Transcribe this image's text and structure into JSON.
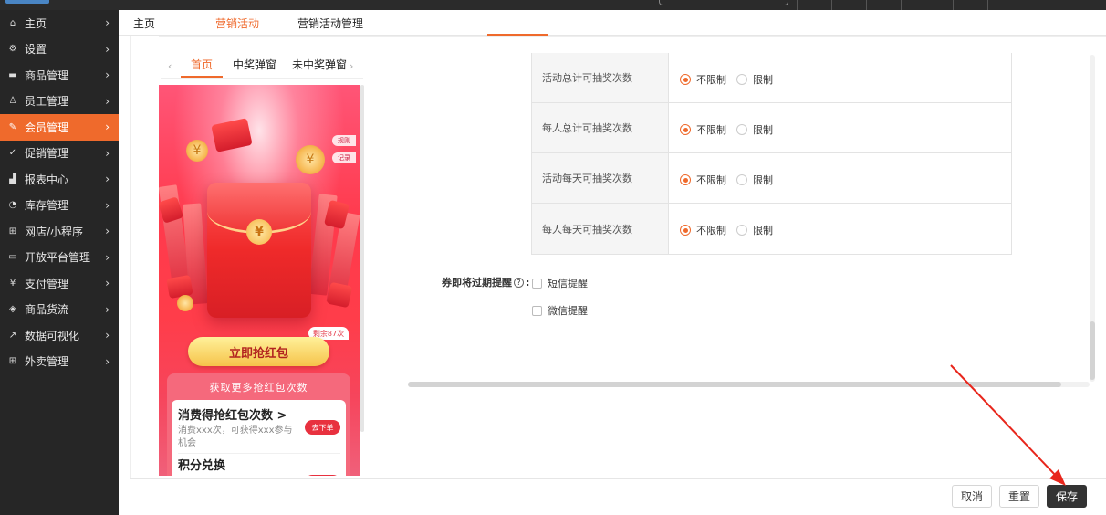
{
  "sidebar": {
    "items": [
      {
        "label": "主页",
        "icon": "home-icon",
        "glyph": "⌂"
      },
      {
        "label": "设置",
        "icon": "gear-icon",
        "glyph": "⚙"
      },
      {
        "label": "商品管理",
        "icon": "product-icon",
        "glyph": "▬"
      },
      {
        "label": "员工管理",
        "icon": "staff-icon",
        "glyph": "♙"
      },
      {
        "label": "会员管理",
        "icon": "member-icon",
        "glyph": "✎",
        "active": true
      },
      {
        "label": "促销管理",
        "icon": "promo-icon",
        "glyph": "✓"
      },
      {
        "label": "报表中心",
        "icon": "report-icon",
        "glyph": "▟"
      },
      {
        "label": "库存管理",
        "icon": "inventory-icon",
        "glyph": "◔"
      },
      {
        "label": "网店/小程序",
        "icon": "shop-icon",
        "glyph": "⊞"
      },
      {
        "label": "开放平台管理",
        "icon": "platform-icon",
        "glyph": "▭"
      },
      {
        "label": "支付管理",
        "icon": "payment-icon",
        "glyph": "¥"
      },
      {
        "label": "商品货流",
        "icon": "goods-flow-icon",
        "glyph": "◈"
      },
      {
        "label": "数据可视化",
        "icon": "data-visual-icon",
        "glyph": "↗"
      },
      {
        "label": "外卖管理",
        "icon": "takeout-icon",
        "glyph": "⊞"
      }
    ]
  },
  "tabs": {
    "home": "主页",
    "marketing": "营销活动",
    "marketing_manage": "营销活动管理"
  },
  "preview": {
    "tabs": [
      "首页",
      "中奖弹窗",
      "未中奖弹窗"
    ],
    "rule_tag": "规则",
    "record_tag": "记录",
    "remaining": "剩余87次",
    "grab_button": "立即抢红包",
    "more_title": "获取更多抢红包次数",
    "card1_title": "消费得抢红包次数 >",
    "card1_desc": "消费xxx次，可获得xxx参与机会",
    "card1_button": "去下单",
    "card2_title": "积分兑换"
  },
  "settings": {
    "rows": [
      {
        "label": "活动总计可抽奖次数",
        "opt1": "不限制",
        "opt2": "限制"
      },
      {
        "label": "每人总计可抽奖次数",
        "opt1": "不限制",
        "opt2": "限制"
      },
      {
        "label": "活动每天可抽奖次数",
        "opt1": "不限制",
        "opt2": "限制"
      },
      {
        "label": "每人每天可抽奖次数",
        "opt1": "不限制",
        "opt2": "限制"
      }
    ],
    "expire_label": "券即将过期提醒",
    "sms_reminder": "短信提醒",
    "wechat_reminder": "微信提醒"
  },
  "footer": {
    "cancel": "取消",
    "reset": "重置",
    "save": "保存"
  },
  "colors": {
    "accent": "#ef6a2c",
    "sidebar_bg": "#262626",
    "primary_button": "#333333",
    "annotation_arrow": "#e8261c"
  }
}
